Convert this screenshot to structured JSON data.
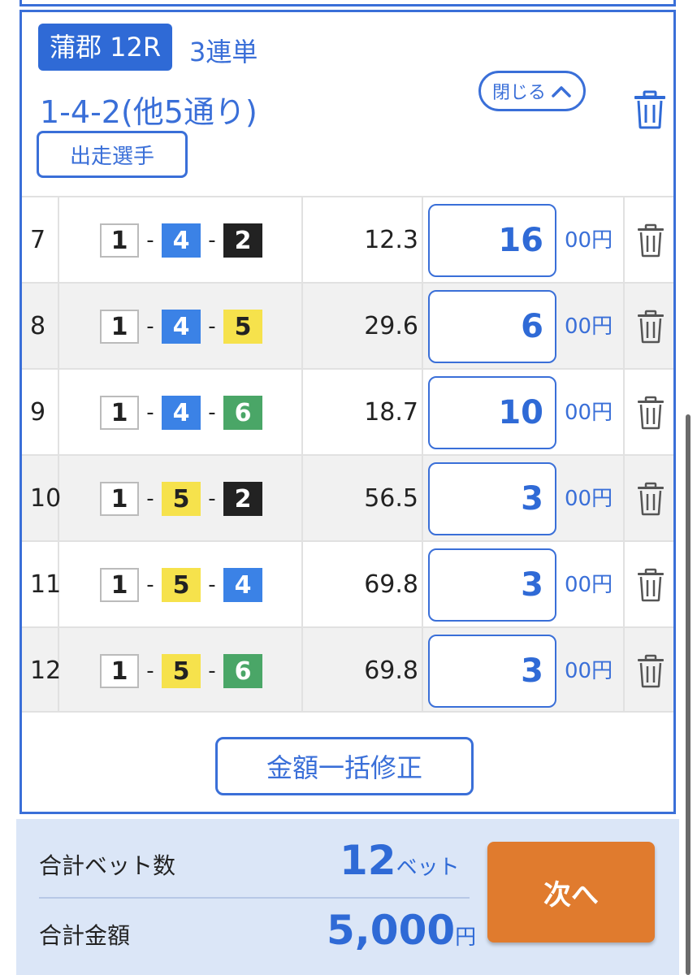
{
  "header": {
    "venue_race": "蒲郡 12R",
    "bet_type": "3連単",
    "combo_summary": "1-4-2(他5通り)",
    "close_label": "閉じる",
    "runners_label": "出走選手"
  },
  "boat_colors": {
    "1": {
      "bg": "#ffffff",
      "fg": "#222222",
      "border": "#bbbbbb"
    },
    "2": {
      "bg": "#222222",
      "fg": "#ffffff",
      "border": "#222222"
    },
    "4": {
      "bg": "#3b82e6",
      "fg": "#ffffff",
      "border": "#3b82e6"
    },
    "5": {
      "bg": "#f6e24c",
      "fg": "#222222",
      "border": "#f6e24c"
    },
    "6": {
      "bg": "#4aa667",
      "fg": "#ffffff",
      "border": "#4aa667"
    }
  },
  "rows": [
    {
      "num": "7",
      "boats": [
        "1",
        "4",
        "2"
      ],
      "odds": "12.3",
      "amount": "16",
      "unit": "00円"
    },
    {
      "num": "8",
      "boats": [
        "1",
        "4",
        "5"
      ],
      "odds": "29.6",
      "amount": "6",
      "unit": "00円"
    },
    {
      "num": "9",
      "boats": [
        "1",
        "4",
        "6"
      ],
      "odds": "18.7",
      "amount": "10",
      "unit": "00円"
    },
    {
      "num": "10",
      "boats": [
        "1",
        "5",
        "2"
      ],
      "odds": "56.5",
      "amount": "3",
      "unit": "00円"
    },
    {
      "num": "11",
      "boats": [
        "1",
        "5",
        "4"
      ],
      "odds": "69.8",
      "amount": "3",
      "unit": "00円"
    },
    {
      "num": "12",
      "boats": [
        "1",
        "5",
        "6"
      ],
      "odds": "69.8",
      "amount": "3",
      "unit": "00円"
    }
  ],
  "bulk_edit_label": "金額一括修正",
  "footer": {
    "bet_count_label": "合計ベット数",
    "bet_count_value": "12",
    "bet_count_unit": "ベット",
    "total_label": "合計金額",
    "total_value": "5,000",
    "total_unit": "円",
    "next_label": "次へ"
  }
}
